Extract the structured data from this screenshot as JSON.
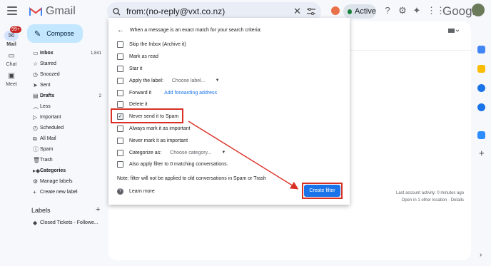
{
  "app": {
    "name": "Gmail",
    "brand_word": "Google",
    "mail_badge": "99+"
  },
  "search": {
    "query": "from:(no-reply@vxt.co.nz)"
  },
  "status": {
    "label": "Active",
    "color": "#188038"
  },
  "rail": {
    "mail": "Mail",
    "chat": "Chat",
    "meet": "Meet"
  },
  "compose": {
    "label": "Compose"
  },
  "nav": [
    {
      "label": "Inbox",
      "count": "1,841",
      "icon": "inbox-icon",
      "bold": true
    },
    {
      "label": "Starred",
      "count": "",
      "icon": "star-icon"
    },
    {
      "label": "Snoozed",
      "count": "",
      "icon": "clock-icon"
    },
    {
      "label": "Sent",
      "count": "",
      "icon": "send-icon"
    },
    {
      "label": "Drafts",
      "count": "2",
      "icon": "draft-icon",
      "bold": true
    },
    {
      "label": "Less",
      "count": "",
      "icon": "chevron-up-icon"
    },
    {
      "label": "Important",
      "count": "",
      "icon": "important-icon"
    },
    {
      "label": "Scheduled",
      "count": "",
      "icon": "scheduled-icon"
    },
    {
      "label": "All Mail",
      "count": "",
      "icon": "all-mail-icon"
    },
    {
      "label": "Spam",
      "count": "",
      "icon": "spam-icon"
    },
    {
      "label": "Trash",
      "count": "",
      "icon": "trash-icon"
    },
    {
      "label": "Categories",
      "count": "",
      "icon": "categories-icon",
      "bold": true
    },
    {
      "label": "Manage labels",
      "count": "",
      "icon": "gear-icon"
    },
    {
      "label": "Create new label",
      "count": "",
      "icon": "plus-icon"
    }
  ],
  "labels": {
    "title": "Labels",
    "items": [
      {
        "label": "Closed Tickets - Followe..."
      }
    ]
  },
  "filter_dialog": {
    "header": "When a message is an exact match for your search criteria:",
    "options": [
      {
        "label": "Skip the Inbox (Archive it)",
        "checked": false
      },
      {
        "label": "Mark as read",
        "checked": false
      },
      {
        "label": "Star it",
        "checked": false
      },
      {
        "label": "Apply the label:",
        "checked": false,
        "select": "Choose label..."
      },
      {
        "label": "Forward it",
        "checked": false,
        "link": "Add forwarding address"
      },
      {
        "label": "Delete it",
        "checked": false
      },
      {
        "label": "Never send it to Spam",
        "checked": true
      },
      {
        "label": "Always mark it as important",
        "checked": false
      },
      {
        "label": "Never mark it as important",
        "checked": false
      },
      {
        "label": "Categorize as:",
        "checked": false,
        "select": "Choose category..."
      },
      {
        "label": "Also apply filter to 0 matching conversations.",
        "checked": false
      }
    ],
    "note": "Note: filter will not be applied to old conversations in Spam or Trash",
    "learn_more": "Learn more",
    "create_button": "Create filter"
  },
  "activity": {
    "line1": "Last account activity: 0 minutes ago",
    "line2": "Open in 1 other location · Details"
  },
  "annotation_color": "#d93025",
  "accent": "#1a73e8"
}
